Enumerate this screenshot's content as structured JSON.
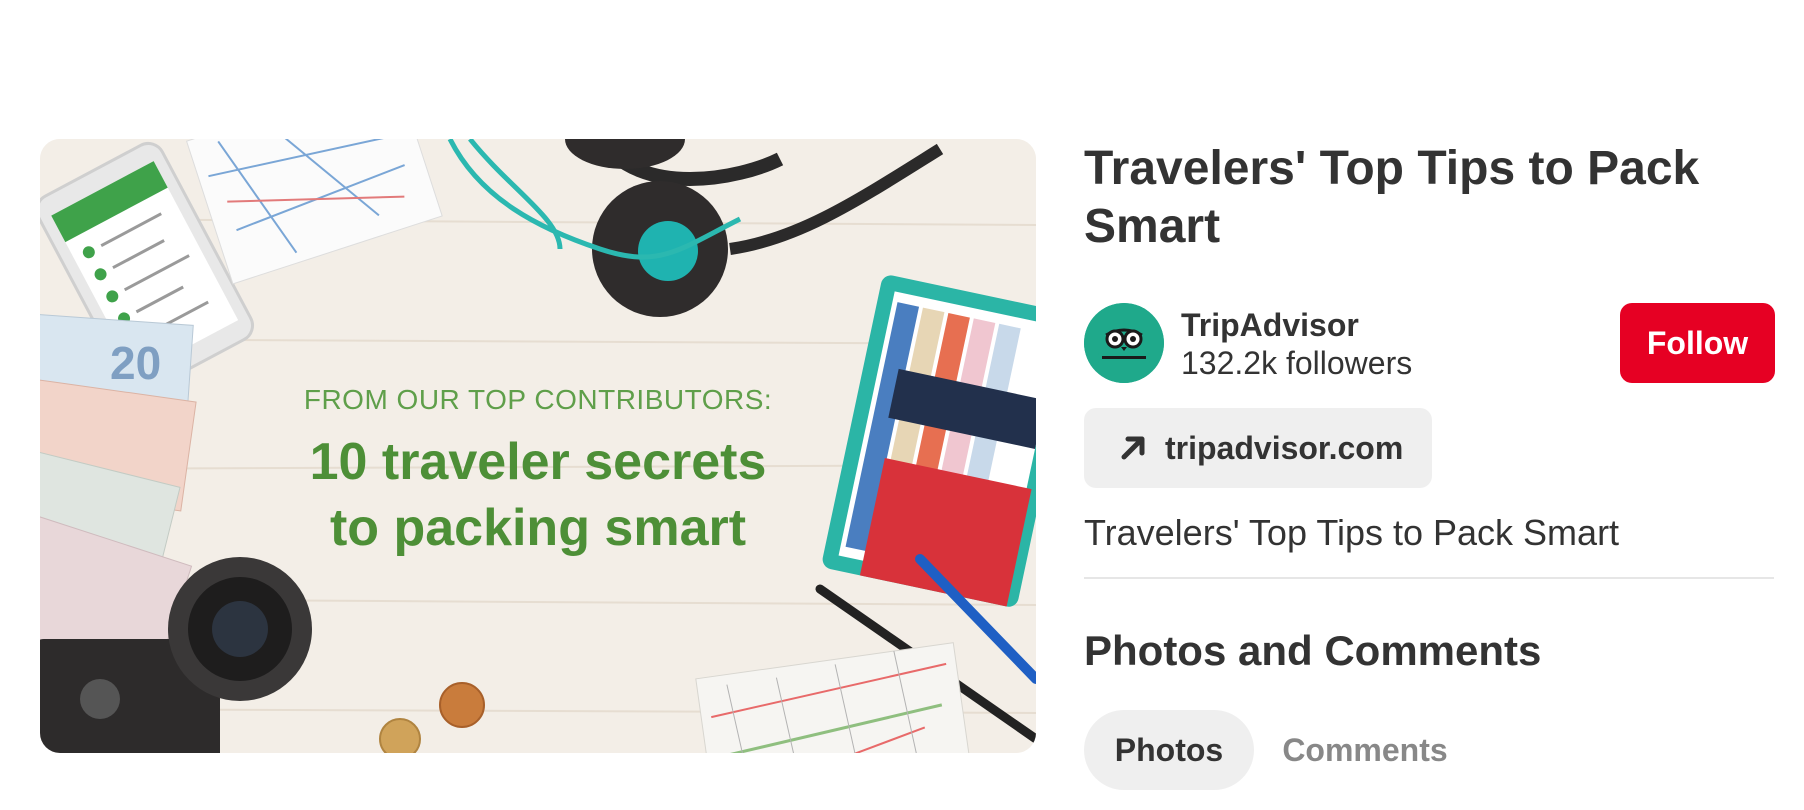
{
  "pin": {
    "image_alt_icon": "pin-image",
    "subheading": "FROM OUR TOP CONTRIBUTORS:",
    "heading_line1": "10 traveler secrets",
    "heading_line2": "to packing smart"
  },
  "title": "Travelers' Top Tips to Pack Smart",
  "creator": {
    "name": "TripAdvisor",
    "followers": "132.2k followers",
    "avatar_color": "#1fa98b",
    "avatar_icon": "tripadvisor-owl-logo"
  },
  "follow_label": "Follow",
  "link": {
    "icon": "arrow-up-right-icon",
    "text": "tripadvisor.com"
  },
  "description": "Travelers' Top Tips to Pack Smart",
  "section_title": "Photos and Comments",
  "tabs": {
    "photos": "Photos",
    "comments": "Comments"
  },
  "colors": {
    "follow_button": "#e60023",
    "link_button_bg": "#efefef",
    "active_tab_bg": "#efefef",
    "inactive_tab_text": "#888888"
  }
}
